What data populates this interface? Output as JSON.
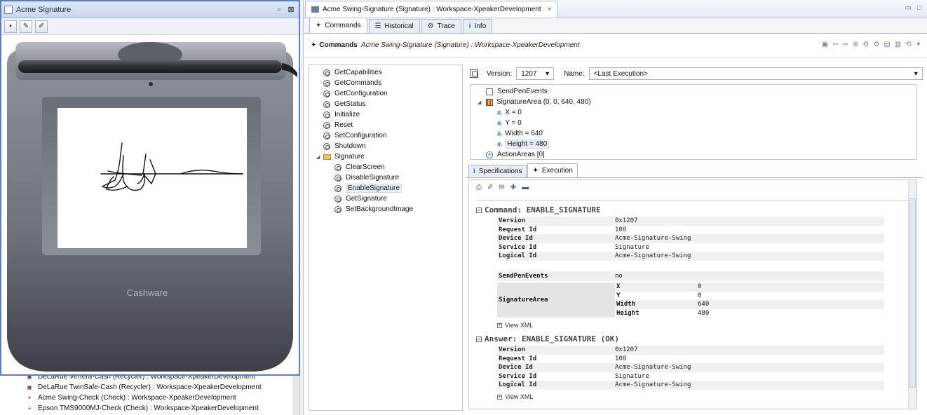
{
  "signature_window": {
    "title": "Acme Signature",
    "device_brand": "Cashware"
  },
  "device_list": [
    {
      "label": "DeLaRue Vertera-Cash (Recycler) : Workspace-XpeakerDevelopment"
    },
    {
      "label": "DeLaRue TwinSafe-Cash (Recycler) : Workspace-XpeakerDevelopment"
    },
    {
      "label": "Acme Swing-Check (Check) : Workspace-XpeakerDevelopment"
    },
    {
      "label": "Epson TMS9000MJ-Check (Check) : Workspace-XpeakerDevelopment"
    }
  ],
  "editor": {
    "tab_title": "Acme Swing-Signature (Signature) : Workspace-XpeakerDevelopment",
    "close": "×"
  },
  "view_tabs": [
    "Commands",
    "Historical",
    "Trace",
    "Info"
  ],
  "commands_header": {
    "title": "Commands",
    "subtitle": "Acme Swing-Signature (Signature) : Workspace-XpeakerDevelopment"
  },
  "command_tree": {
    "root_items": [
      "GetCapabilities",
      "GetCommands",
      "GetConfiguration",
      "GetStatus",
      "Initialize",
      "Reset",
      "SetConfiguration",
      "Shutdown"
    ],
    "folder": "Signature",
    "folder_items": [
      "ClearScreen",
      "DisableSignature",
      "EnableSignature",
      "GetSignature",
      "SetBackgroundImage"
    ]
  },
  "props": {
    "version_label": "Version:",
    "version_value": "1207",
    "name_label": "Name:",
    "name_value": "<Last Execution>",
    "tree": {
      "send_pen_events": "SendPenEvents",
      "signature_area": "SignatureArea (0, 0, 640, 480)",
      "x": "X = 0",
      "y": "Y = 0",
      "width": "Width = 640",
      "height": "Height = 480",
      "action_areas": "ActionAreas [0]"
    }
  },
  "exec_tabs": [
    "Specifications",
    "Execution"
  ],
  "execution": {
    "command_title": "Command: ENABLE_SIGNATURE",
    "command_rows": [
      {
        "k": "Version",
        "v": "0x1207"
      },
      {
        "k": "Request Id",
        "v": "108"
      },
      {
        "k": "Device Id",
        "v": "Acme-Signature-Swing"
      },
      {
        "k": "Service Id",
        "v": "Signature"
      },
      {
        "k": "Logical Id",
        "v": "Acme-Signature-Swing"
      }
    ],
    "send_pen_events_key": "SendPenEvents",
    "send_pen_events_value": "no",
    "signature_area_key": "SignatureArea",
    "signature_area_rows": [
      {
        "k": "X",
        "v": "0"
      },
      {
        "k": "Y",
        "v": "0"
      },
      {
        "k": "Width",
        "v": "640"
      },
      {
        "k": "Height",
        "v": "480"
      }
    ],
    "view_xml": "View XML",
    "answer_title": "Answer: ENABLE_SIGNATURE (OK)",
    "answer_rows": [
      {
        "k": "Version",
        "v": "0x1207"
      },
      {
        "k": "Request Id",
        "v": "108"
      },
      {
        "k": "Device Id",
        "v": "Acme-Signature-Swing"
      },
      {
        "k": "Service Id",
        "v": "Signature"
      },
      {
        "k": "Logical Id",
        "v": "Acme-Signature-Swing"
      }
    ]
  }
}
